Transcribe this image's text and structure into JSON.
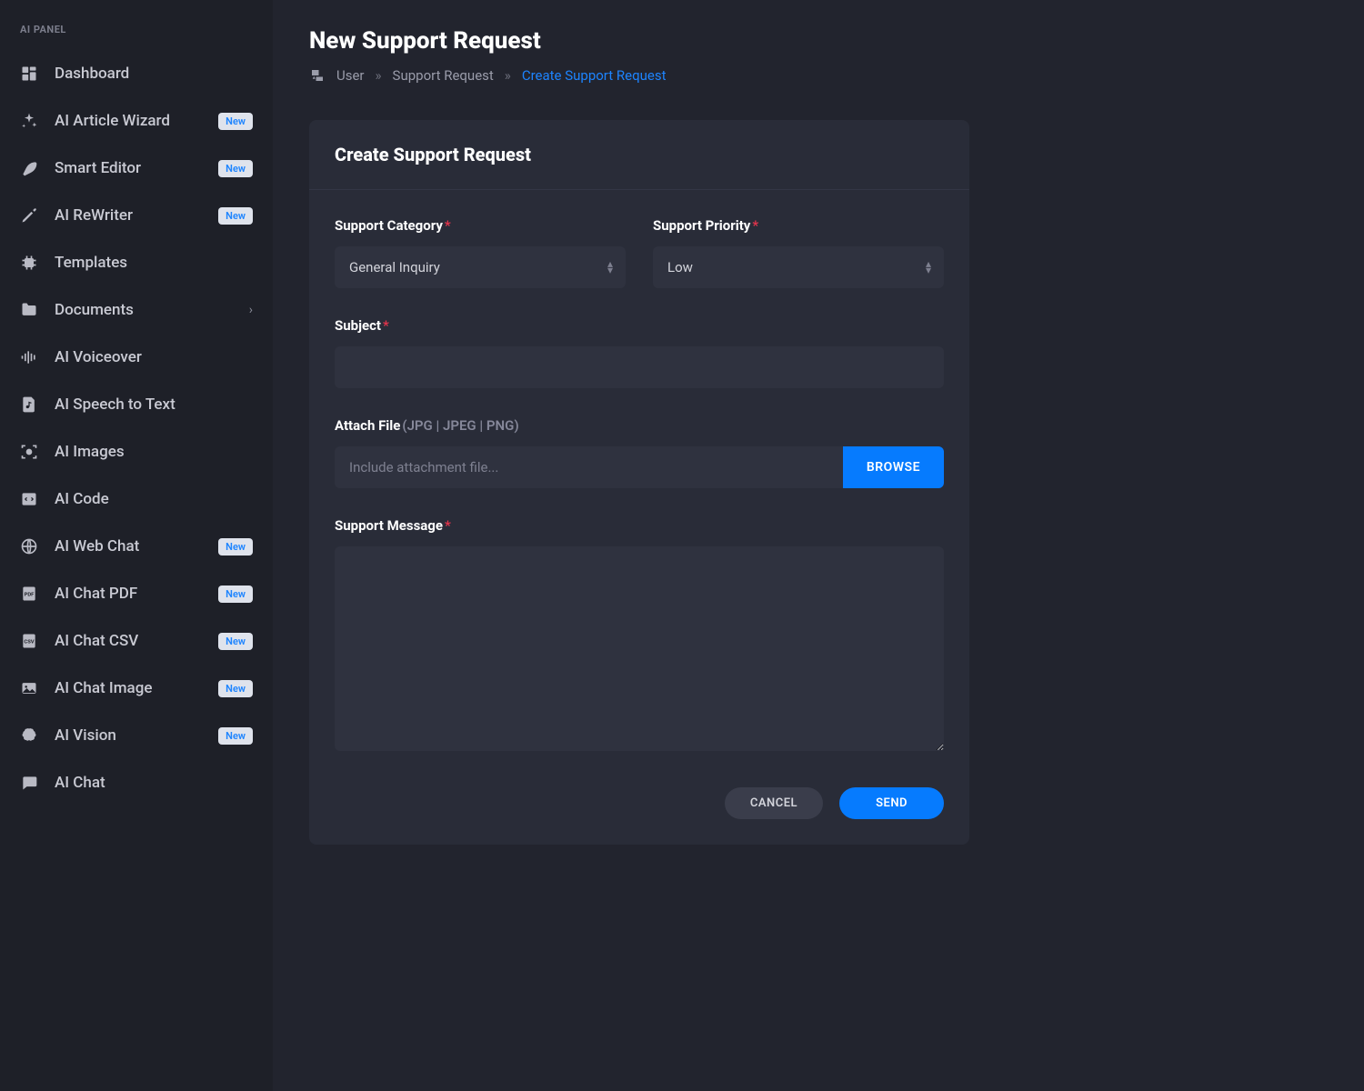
{
  "sidebar": {
    "title": "AI PANEL",
    "items": [
      {
        "label": "Dashboard",
        "icon": "dashboard",
        "badge": null,
        "chevron": false
      },
      {
        "label": "AI Article Wizard",
        "icon": "sparkles",
        "badge": "New",
        "chevron": false
      },
      {
        "label": "Smart Editor",
        "icon": "feather",
        "badge": "New",
        "chevron": false
      },
      {
        "label": "AI ReWriter",
        "icon": "pen",
        "badge": "New",
        "chevron": false
      },
      {
        "label": "Templates",
        "icon": "chip",
        "badge": null,
        "chevron": false
      },
      {
        "label": "Documents",
        "icon": "folder",
        "badge": null,
        "chevron": true
      },
      {
        "label": "AI Voiceover",
        "icon": "waveform",
        "badge": null,
        "chevron": false
      },
      {
        "label": "AI Speech to Text",
        "icon": "music-file",
        "badge": null,
        "chevron": false
      },
      {
        "label": "AI Images",
        "icon": "scan",
        "badge": null,
        "chevron": false
      },
      {
        "label": "AI Code",
        "icon": "code",
        "badge": null,
        "chevron": false
      },
      {
        "label": "AI Web Chat",
        "icon": "globe",
        "badge": "New",
        "chevron": false
      },
      {
        "label": "AI Chat PDF",
        "icon": "pdf",
        "badge": "New",
        "chevron": false
      },
      {
        "label": "AI Chat CSV",
        "icon": "csv",
        "badge": "New",
        "chevron": false
      },
      {
        "label": "AI Chat Image",
        "icon": "image",
        "badge": "New",
        "chevron": false
      },
      {
        "label": "AI Vision",
        "icon": "brain",
        "badge": "New",
        "chevron": false
      },
      {
        "label": "AI Chat",
        "icon": "chat",
        "badge": null,
        "chevron": false
      }
    ]
  },
  "page": {
    "title": "New Support Request",
    "breadcrumb": [
      "User",
      "Support Request",
      "Create Support Request"
    ]
  },
  "card": {
    "title": "Create Support Request",
    "labels": {
      "category": "Support Category",
      "priority": "Support Priority",
      "subject": "Subject",
      "attach": "Attach File ",
      "attach_hint": "(JPG | JPEG | PNG)",
      "attach_placeholder": "Include attachment file...",
      "browse": "BROWSE",
      "message": "Support Message",
      "cancel": "CANCEL",
      "send": "SEND"
    },
    "values": {
      "category": "General Inquiry",
      "priority": "Low",
      "subject": "",
      "attachment": "",
      "message": ""
    }
  }
}
